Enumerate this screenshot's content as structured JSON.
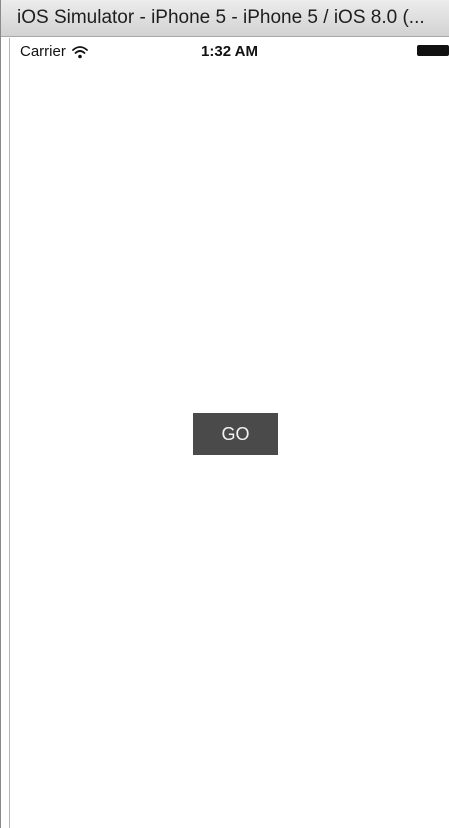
{
  "window": {
    "title": "iOS Simulator - iPhone 5 - iPhone 5 / iOS 8.0 (..."
  },
  "statusbar": {
    "carrier": "Carrier",
    "wifi_icon": "wifi-icon",
    "time": "1:32 AM",
    "battery_icon": "battery-full-icon"
  },
  "main": {
    "go_button_label": "GO",
    "go_button_color": "#4a4a4a"
  }
}
